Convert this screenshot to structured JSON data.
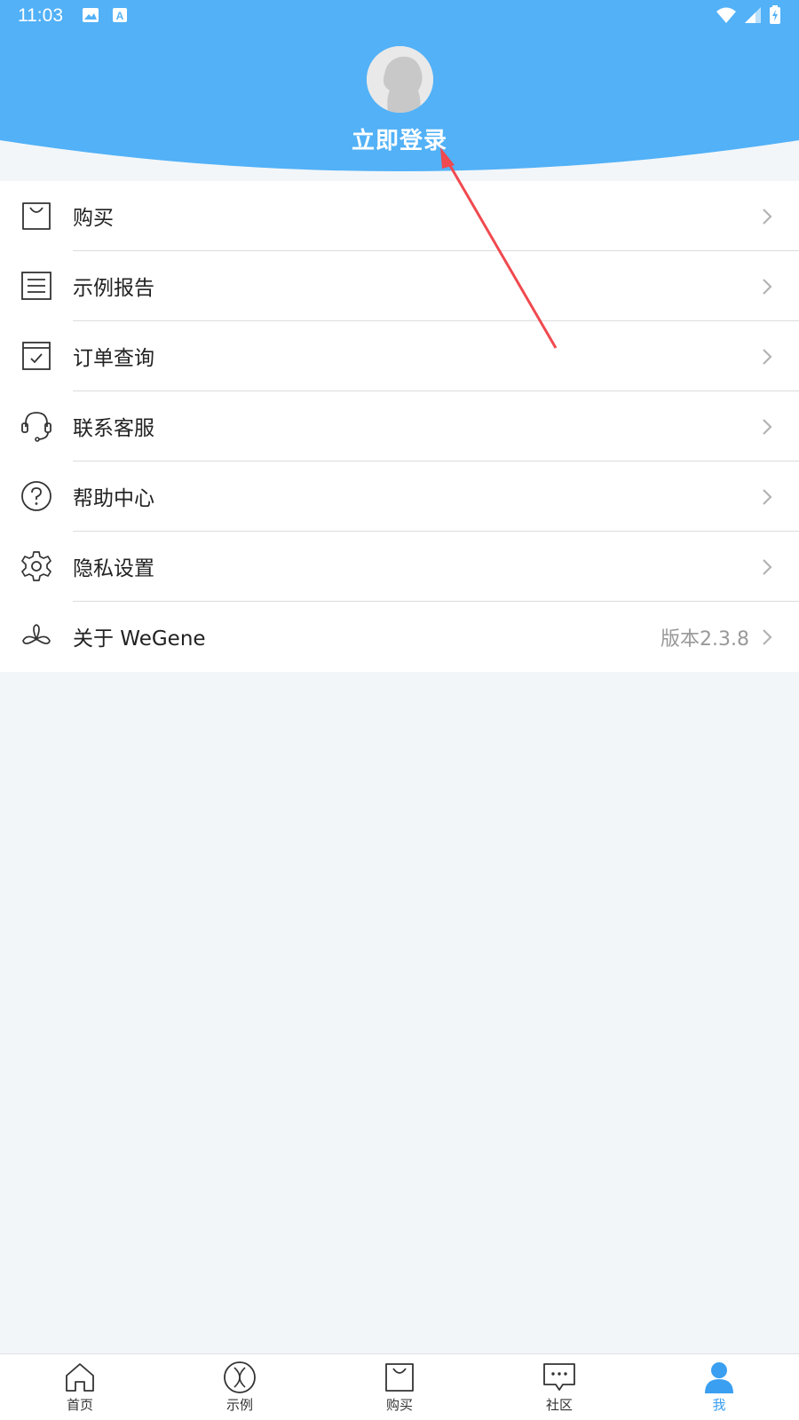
{
  "status_bar": {
    "time": "11:03",
    "left_icons": [
      "image-icon",
      "a-notification-icon"
    ],
    "right_icons": [
      "wifi-icon",
      "signal-icon",
      "battery-charging-icon"
    ]
  },
  "header": {
    "login_label": "立即登录",
    "background_color": "#52b1f7"
  },
  "menu": {
    "items": [
      {
        "label": "购买",
        "icon": "shopping-bag-icon"
      },
      {
        "label": "示例报告",
        "icon": "document-list-icon"
      },
      {
        "label": "订单查询",
        "icon": "calendar-check-icon"
      },
      {
        "label": "联系客服",
        "icon": "headset-icon"
      },
      {
        "label": "帮助中心",
        "icon": "help-circle-icon"
      },
      {
        "label": "隐私设置",
        "icon": "gear-icon"
      },
      {
        "label": "关于 WeGene",
        "icon": "wegene-logo-icon",
        "value": "版本2.3.8"
      }
    ]
  },
  "tab_bar": {
    "active_color": "#3a9ff0",
    "tabs": [
      {
        "label": "首页",
        "icon": "home-icon"
      },
      {
        "label": "示例",
        "icon": "dna-circle-icon"
      },
      {
        "label": "购买",
        "icon": "shopping-bag-icon"
      },
      {
        "label": "社区",
        "icon": "chat-bubble-icon"
      },
      {
        "label": "我",
        "icon": "user-icon",
        "active": true
      }
    ]
  },
  "annotation": {
    "arrow_color": "#f0494f"
  }
}
